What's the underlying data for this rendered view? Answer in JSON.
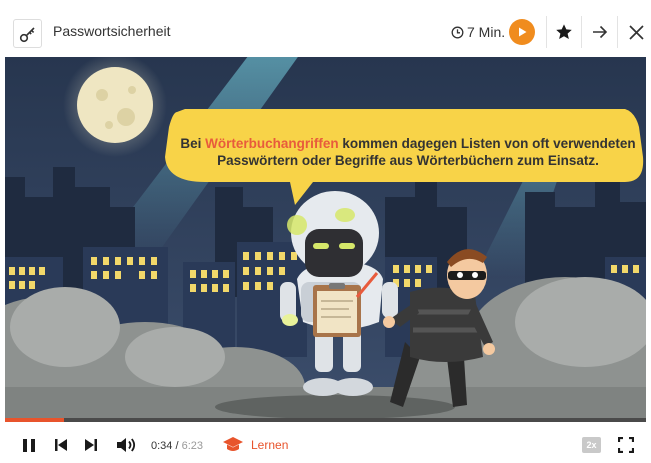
{
  "header": {
    "title": "Passwortsicherheit",
    "duration": "7 Min.",
    "icons": {
      "lesson": "key-icon",
      "clock": "clock-icon",
      "play": "play-icon",
      "favorite": "star-icon",
      "next": "arrow-right-icon",
      "close": "close-icon"
    }
  },
  "video": {
    "bubble": {
      "highlight": "Wörterbuchangriffen",
      "text_rest_1": " kommen dagegen Listen von oft verwendeten",
      "line_2": "Passwörtern oder Begriffe aus Wörterbüchern zum Einsatz.",
      "prefix": "Bei "
    },
    "progress_fraction": 0.092
  },
  "controls": {
    "current_time": "0:34",
    "separator": " / ",
    "total_time": "6:23",
    "learn_label": "Lernen",
    "speed_label": "2x",
    "icons": [
      "pause-icon",
      "skip-back-icon",
      "skip-forward-icon",
      "volume-icon",
      "graduation-cap-icon",
      "fullscreen-icon"
    ]
  },
  "colors": {
    "accent": "#f08c1e",
    "progress": "#e8542c",
    "highlight": "#e85b3c",
    "bubble": "#f8d348",
    "night_sky": "#2d3d57"
  }
}
